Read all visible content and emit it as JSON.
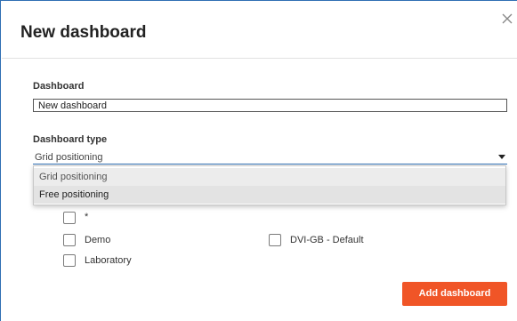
{
  "dialog": {
    "title": "New dashboard",
    "close_label": "×"
  },
  "form": {
    "dashboard_label": "Dashboard",
    "dashboard_value": "New dashboard",
    "type_label": "Dashboard type",
    "type_selected": "Grid positioning",
    "type_options": [
      "Grid positioning",
      "Free positioning"
    ]
  },
  "categories": {
    "items": [
      {
        "label": "*",
        "checked": false
      },
      {
        "label": "Demo",
        "checked": false
      },
      {
        "label": "DVI-GB - Default",
        "checked": false
      },
      {
        "label": "Laboratory",
        "checked": false
      }
    ]
  },
  "actions": {
    "add_label": "Add dashboard"
  },
  "colors": {
    "accent": "#f05527",
    "border": "#2f6fb3"
  }
}
